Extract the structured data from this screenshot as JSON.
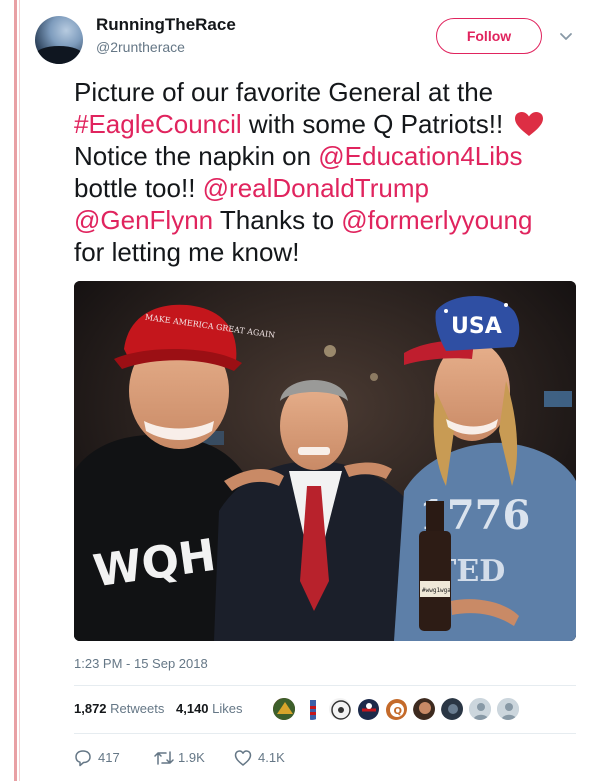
{
  "author": {
    "display_name": "RunningTheRace",
    "handle": "@2runtherace"
  },
  "follow_label": "Follow",
  "tweet": {
    "parts": [
      "Picture of our favorite General at the ",
      "#EagleCouncil",
      " with some Q Patriots!! ",
      "Notice the napkin on ",
      "@Education4Libs",
      " bottle too!! ",
      "@realDonaldTrump",
      "@GenFlynn",
      " Thanks to ",
      "@formerlyyoung",
      " for letting me know!"
    ],
    "emoji": "red-heart"
  },
  "photo": {
    "hat_text": "MAKE AMERICA GREAT AGAIN",
    "shirt_text": "WQH",
    "shirt2_text": "1776",
    "shirt2_text_b": "TED",
    "cap_text": "USA",
    "bottle_label": "#wwg1wga"
  },
  "timestamp": "1:23 PM - 15 Sep 2018",
  "stats": {
    "retweets_count": "1,872",
    "retweets_label": "Retweets",
    "likes_count": "4,140",
    "likes_label": "Likes"
  },
  "actions": {
    "replies": "417",
    "retweets": "1.9K",
    "likes": "4.1K"
  },
  "colors": {
    "accent": "#e0245e",
    "muted": "#657786",
    "text": "#14171a"
  }
}
